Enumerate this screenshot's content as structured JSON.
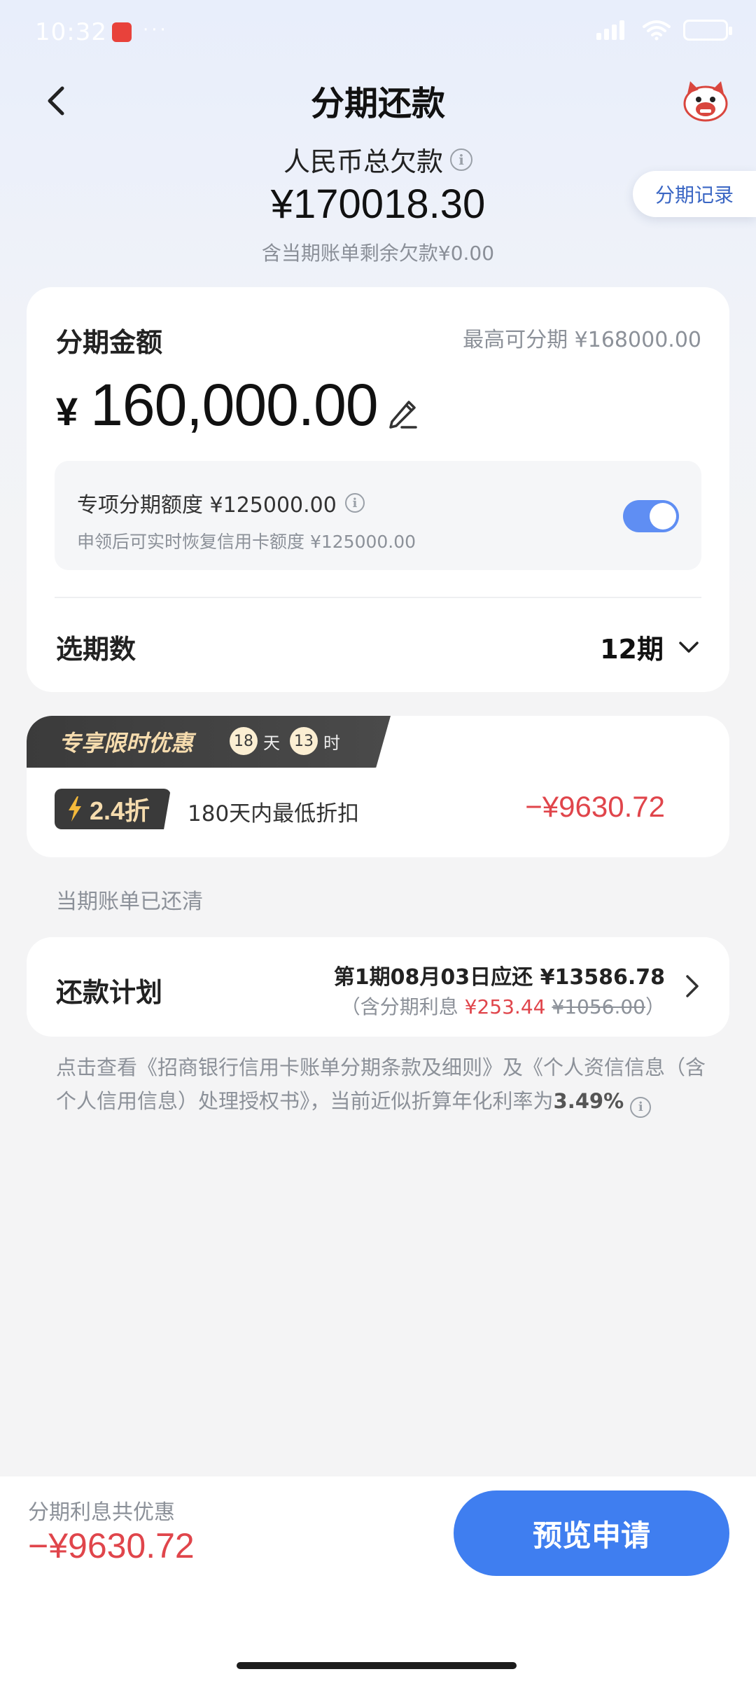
{
  "status_bar": {
    "time": "10:32",
    "dots": "···"
  },
  "header": {
    "title": "分期还款"
  },
  "debt": {
    "label": "人民币总欠款",
    "total": "¥170018.30",
    "sub": "含当期账单剩余欠款¥0.00",
    "records_label": "分期记录"
  },
  "amount_card": {
    "title": "分期金额",
    "max_label": "最高可分期 ¥168000.00",
    "currency": "¥",
    "amount": "160,000.00",
    "quota_title": "专项分期额度 ¥125000.00",
    "quota_desc": "申领后可实时恢复信用卡额度 ¥125000.00",
    "quota_toggle_on": true,
    "period_label": "选期数",
    "period_value": "12期"
  },
  "promo": {
    "title": "专享限时优惠",
    "days": "18",
    "days_unit": "天",
    "hours": "13",
    "hours_unit": "时",
    "discount": "2.4折",
    "discount_desc": "180天内最低折扣",
    "discount_amount": "−¥9630.72"
  },
  "bill_status": "当期账单已还清",
  "plan": {
    "label": "还款计划",
    "line1": "第1期08月03日应还 ¥13586.78",
    "line2_prefix": "（含分期利息 ",
    "interest": "¥253.44",
    "original_interest": "¥1056.00",
    "line2_suffix": "）"
  },
  "terms": {
    "text": "点击查看《招商银行信用卡账单分期条款及细则》及《个人资信信息（含个人信用信息）处理授权书》，当前近似折算年化利率为",
    "rate": "3.49%"
  },
  "bottom": {
    "savings_label": "分期利息共优惠",
    "savings_value": "−¥9630.72",
    "apply_label": "预览申请"
  },
  "colors": {
    "accent_blue": "#3f7ef0",
    "discount_red": "#e0454b",
    "promo_gold": "#f6dcae"
  }
}
